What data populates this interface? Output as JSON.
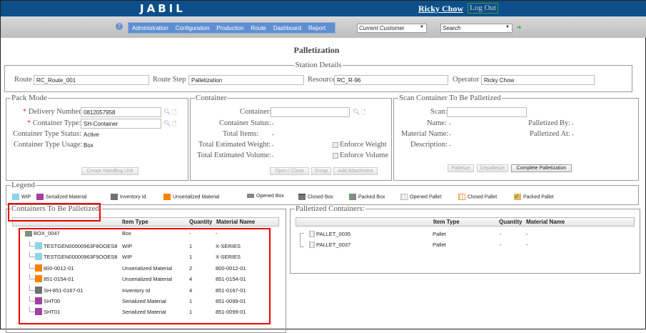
{
  "header": {
    "logo": "JABIL",
    "user": "Ricky Chow",
    "logout": "Log Out"
  },
  "nav": {
    "help_icon": "help-icon",
    "menu": [
      "Administration",
      "Configuration",
      "Production",
      "Route",
      "Dashboard",
      "Report"
    ],
    "customer_select": "Current Customer",
    "search_select": "Search",
    "go_icon": "arrow-right-icon"
  },
  "page_title": "Palletization",
  "station": {
    "legend": "Station Details",
    "route_label": "Route",
    "route": "RC_Route_001",
    "step_label": "Route Step",
    "step": "Palletization",
    "resource_label": "Resource",
    "resource": "RC_R-96",
    "operator_label": "Operator",
    "operator": "Ricky Chow"
  },
  "pack": {
    "legend": "Pack Mode",
    "delivery_label": "Delivery Number:",
    "delivery": "0812057958",
    "ctype_label": "Container Type:",
    "ctype": "SH-Container",
    "status_label": "Container Type Status:",
    "status": "Active",
    "usage_label": "Container Type Usage:",
    "usage": "Box",
    "create_btn": "Create Handling Unit",
    "req": "*"
  },
  "container": {
    "legend": "Container",
    "container_label": "Container:",
    "status_label": "Container Status:",
    "status": "-",
    "items_label": "Total Items:",
    "items": "-",
    "weight_label": "Total Estimated Weight:",
    "weight": "-",
    "volume_label": "Total Estimated Volume:",
    "volume": "-",
    "enforce_weight": "Enforce Weight",
    "enforce_volume": "Enforce Volume",
    "open_close": "Open / Close",
    "scrap": "Scrap",
    "attach": "Add Attachment"
  },
  "scan": {
    "legend": "Scan Container To Be Palletized",
    "scan_label": "Scan:",
    "name_label": "Name:",
    "name": "-",
    "material_label": "Material Name:",
    "material": "-",
    "desc_label": "Description:",
    "desc": "-",
    "by_label": "Palletized By:",
    "by": "-",
    "at_label": "Palletized At:",
    "at": "-",
    "palletize": "Palletize",
    "depalletize": "Depalletize",
    "complete": "Complete Palletization"
  },
  "legend": {
    "title": "Legend",
    "items": [
      "WIP",
      "Serialized Material",
      "Inventory Id",
      "Unserialized Material",
      "Opened Box",
      "Closed Box",
      "Packed Box",
      "Opened Pallet",
      "Closed Pallet",
      "Packed Pallet"
    ],
    "colors": {
      "wip": "#8fd3e8",
      "serialized": "#a040a0",
      "inventory": "#707070",
      "unserialized": "#ff8000"
    }
  },
  "to_palletize": {
    "legend": "Containers To Be Palletized:",
    "headers": [
      "Item Type",
      "Quantity",
      "Material Name"
    ],
    "root": {
      "name": "BOX_0047",
      "type": "Box",
      "qty": "-",
      "mat": "-"
    },
    "rows": [
      {
        "name": "TESTGEN00000963F8OOES8",
        "type": "WIP",
        "qty": "1",
        "mat": "X-SERIES",
        "color": "#8fd3e8"
      },
      {
        "name": "TESTGEN00000963F9OOES8",
        "type": "WIP",
        "qty": "1",
        "mat": "X-SERIES",
        "color": "#8fd3e8"
      },
      {
        "name": "800-0012-01",
        "type": "Unserialized Material",
        "qty": "2",
        "mat": "800-0012-01",
        "color": "#ff8000"
      },
      {
        "name": "851-0154-01",
        "type": "Unserialized Material",
        "qty": "4",
        "mat": "851-0154-01",
        "color": "#ff8000"
      },
      {
        "name": "SH-851-0167-01",
        "type": "Inventory Id",
        "qty": "4",
        "mat": "851-0167-01",
        "color": "#707070"
      },
      {
        "name": "SHT00",
        "type": "Serialized Material",
        "qty": "1",
        "mat": "851-0099-01",
        "color": "#a040a0"
      },
      {
        "name": "SHT01",
        "type": "Serialized Material",
        "qty": "1",
        "mat": "851-0099-01",
        "color": "#a040a0"
      }
    ]
  },
  "palletized": {
    "legend": "Palletized Containers:",
    "headers": [
      "Item Type",
      "Quantity",
      "Material Name"
    ],
    "rows": [
      {
        "name": "PALLET_0035",
        "type": "Pallet",
        "qty": "-",
        "mat": "-"
      },
      {
        "name": "PALLET_0037",
        "type": "Pallet",
        "qty": "-",
        "mat": "-"
      }
    ]
  }
}
